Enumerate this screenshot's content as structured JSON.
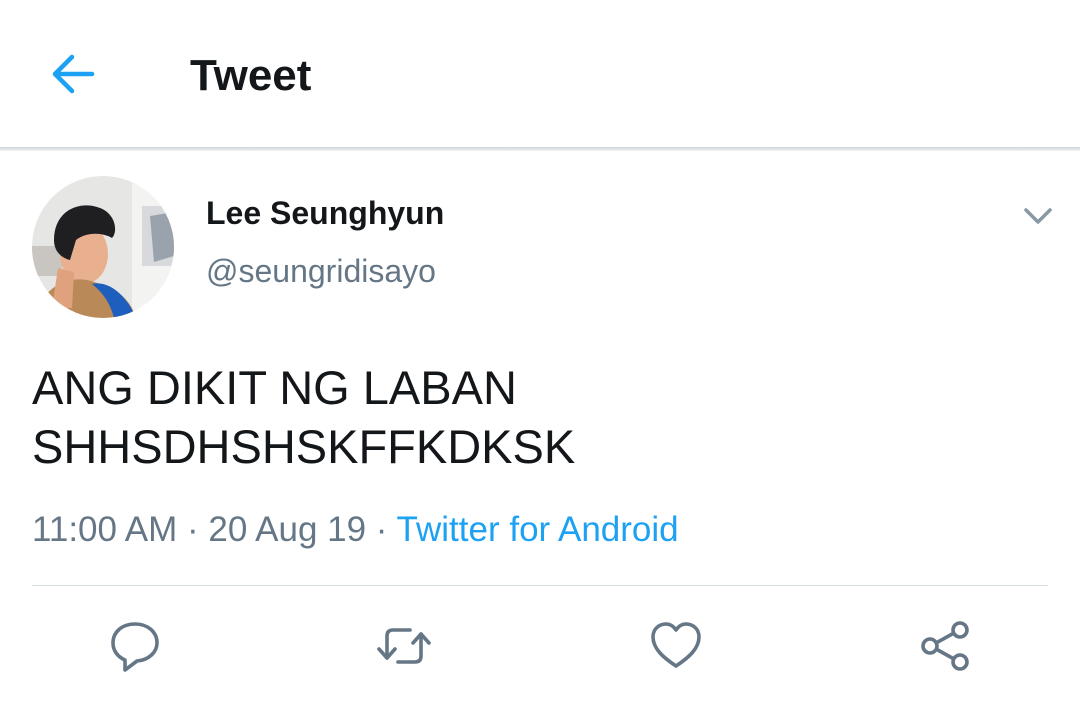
{
  "header": {
    "title": "Tweet",
    "back_icon": "arrow-left-icon"
  },
  "tweet": {
    "author": {
      "display_name": "Lee Seunghyun",
      "handle": "@seungridisayo",
      "avatar": "profile-photo"
    },
    "text_lines": [
      "ANG DIKIT NG LABAN",
      "SHHSDHSHSKFFKDKSK"
    ],
    "meta": {
      "time": "11:00 AM",
      "separator": "·",
      "date": "20 Aug 19",
      "source": "Twitter for Android"
    },
    "actions": [
      "reply-icon",
      "retweet-icon",
      "like-icon",
      "share-icon"
    ]
  },
  "colors": {
    "accent": "#1da1f2",
    "text_primary": "#14171a",
    "text_secondary": "#657786",
    "icon_gray": "#657786"
  }
}
